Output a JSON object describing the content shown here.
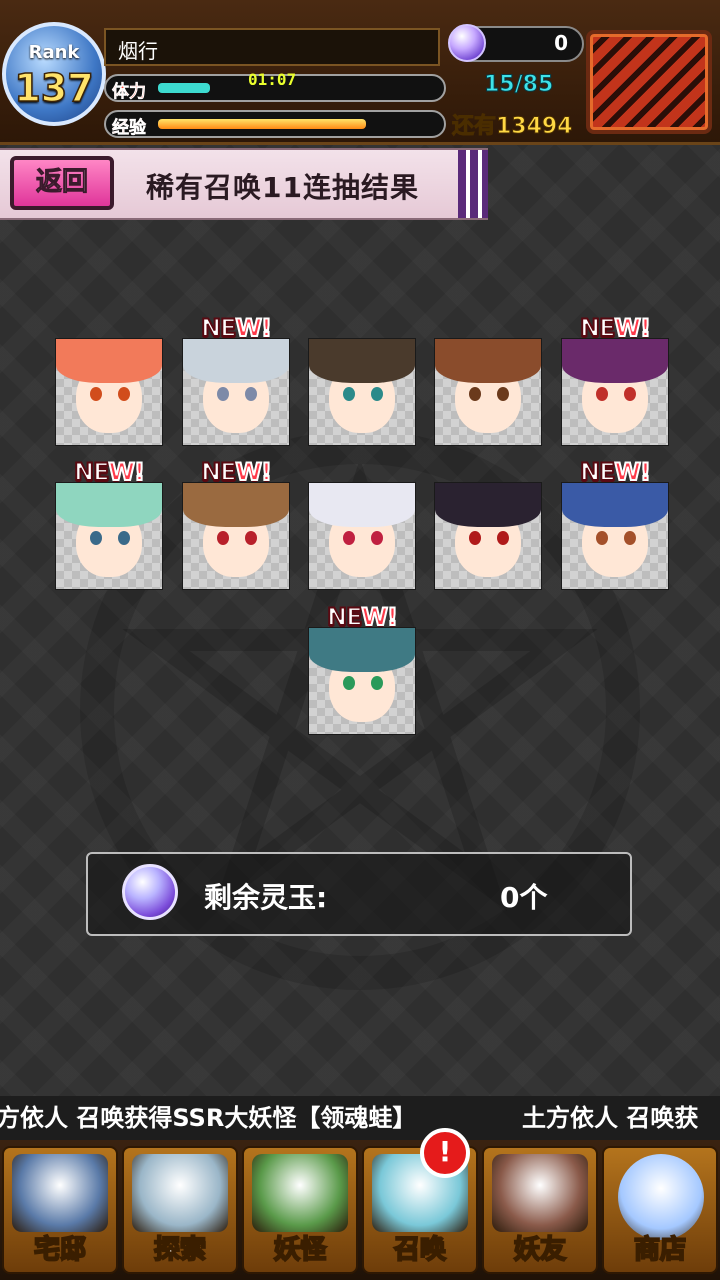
{
  "header": {
    "rank_label": "Rank",
    "rank_value": "137",
    "player_name": "烟行",
    "stamina_label": "体力",
    "stamina_timer": "01:07",
    "stamina_value": "15/85",
    "exp_label": "经验",
    "exp_remaining": "还有13494",
    "orb_count": "0"
  },
  "page": {
    "back_label": "返回",
    "title": "稀有召唤11连抽结果"
  },
  "results": [
    {
      "new": false,
      "hair": "#f27a5a",
      "eye": "#d14d1c",
      "bg": "#d9d9d9"
    },
    {
      "new": true,
      "hair": "#c9d3dc",
      "eye": "#7d8aa8",
      "bg": "#e9e9e9"
    },
    {
      "new": false,
      "hair": "#4a3a2c",
      "eye": "#2b8a8a",
      "bg": "#dcdcdc"
    },
    {
      "new": false,
      "hair": "#8a4c2c",
      "eye": "#6b3a1c",
      "bg": "#e0d6d0"
    },
    {
      "new": true,
      "hair": "#6a2a6a",
      "eye": "#c0302a",
      "bg": "#d4c8d8"
    },
    {
      "new": true,
      "hair": "#8fd6bf",
      "eye": "#3a6a8a",
      "bg": "#dfe9e6"
    },
    {
      "new": true,
      "hair": "#9a6a40",
      "eye": "#b8202a",
      "bg": "#ded4cc"
    },
    {
      "new": false,
      "hair": "#e8e8f2",
      "eye": "#c02040",
      "bg": "#e4e4ee"
    },
    {
      "new": false,
      "hair": "#2a2230",
      "eye": "#b01a1a",
      "bg": "#d4d4d4"
    },
    {
      "new": true,
      "hair": "#3a5aa6",
      "eye": "#a4502a",
      "bg": "#d8dced"
    },
    {
      "new": true,
      "hair": "#3f7a84",
      "eye": "#2a9a5a",
      "bg": "#d9e6e8"
    }
  ],
  "new_label": {
    "pre": "NE",
    "w": "W",
    "bang": "!"
  },
  "orb_box": {
    "label": "剩余灵玉:",
    "count": "0个"
  },
  "ticker": {
    "text1": "方依人 召唤获得SSR大妖怪【领魂蛙】",
    "text2": "土方依人 召唤获"
  },
  "nav": [
    {
      "label": "宅邸",
      "icon": "house-icon",
      "color": "#5a7aa8"
    },
    {
      "label": "探索",
      "icon": "magnifier-icon",
      "color": "#9ab6c8"
    },
    {
      "label": "妖怪",
      "icon": "scroll-icon",
      "color": "#5a9a4a"
    },
    {
      "label": "召唤",
      "icon": "pentagram-icon",
      "color": "#7ac8d8"
    },
    {
      "label": "妖友",
      "icon": "cat-girl-icon",
      "color": "#8a5a4a"
    },
    {
      "label": "商店",
      "icon": "orb-icon",
      "color": "#a4c8ff"
    }
  ],
  "notification_badge": "!"
}
